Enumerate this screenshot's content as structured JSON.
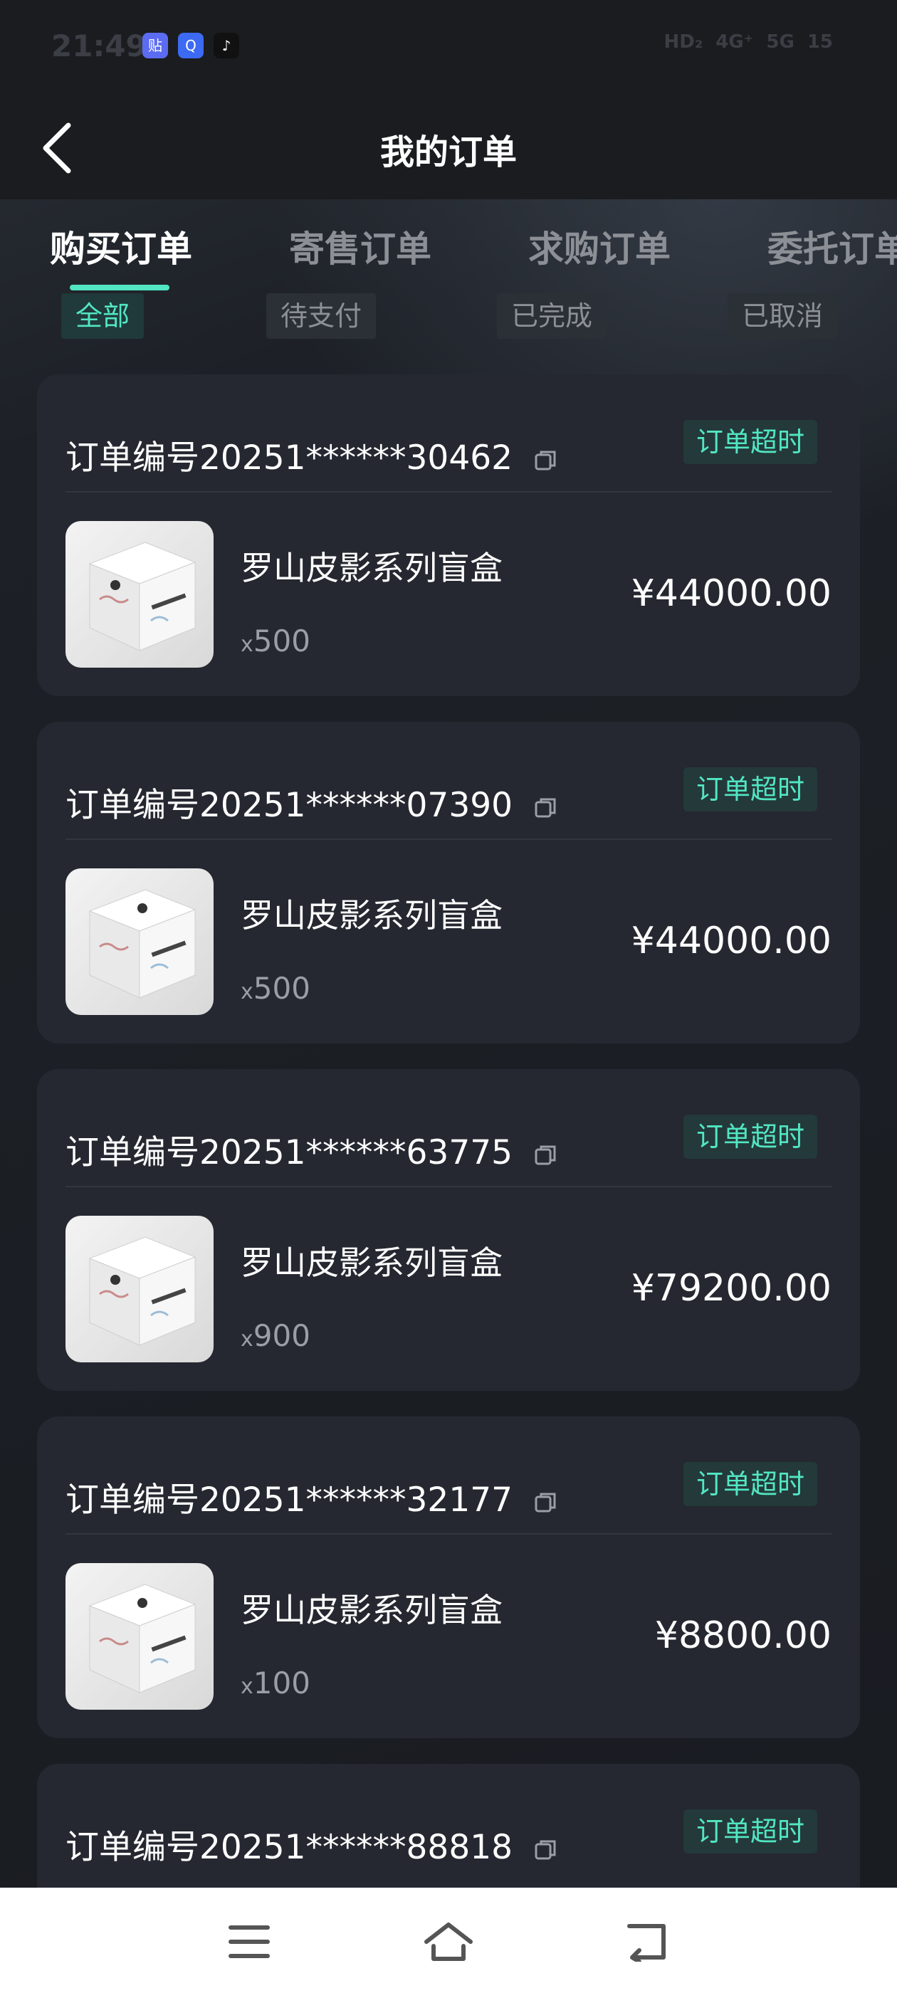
{
  "status_bar": {
    "time": "21:49",
    "apps": [
      {
        "icon": "tieba-icon",
        "glyph": "贴",
        "color": "#5b6cf2"
      },
      {
        "icon": "qq-icon",
        "glyph": "Q",
        "color": "#3d6af2"
      },
      {
        "icon": "music-icon",
        "glyph": "♪",
        "color": "#111111"
      }
    ],
    "right_items": [
      "HD₂",
      "4G⁺",
      "5G",
      "15"
    ]
  },
  "header": {
    "title": "我的订单",
    "back_icon": "chevron-left-icon"
  },
  "tabs": [
    {
      "label": "购买订单",
      "active": true
    },
    {
      "label": "寄售订单",
      "active": false
    },
    {
      "label": "求购订单",
      "active": false
    },
    {
      "label": "委托订单",
      "active": false
    }
  ],
  "subtabs": [
    {
      "label": "全部",
      "active": true
    },
    {
      "label": "待支付",
      "active": false
    },
    {
      "label": "已完成",
      "active": false
    },
    {
      "label": "已取消",
      "active": false
    }
  ],
  "orders": [
    {
      "order_no": "订单编号20251******30462",
      "status": "订单超时",
      "product": "罗山皮影系列盲盒",
      "qty_prefix": "x",
      "qty": "500",
      "price": "¥44000.00"
    },
    {
      "order_no": "订单编号20251******07390",
      "status": "订单超时",
      "product": "罗山皮影系列盲盒",
      "qty_prefix": "x",
      "qty": "500",
      "price": "¥44000.00"
    },
    {
      "order_no": "订单编号20251******63775",
      "status": "订单超时",
      "product": "罗山皮影系列盲盒",
      "qty_prefix": "x",
      "qty": "900",
      "price": "¥79200.00"
    },
    {
      "order_no": "订单编号20251******32177",
      "status": "订单超时",
      "product": "罗山皮影系列盲盒",
      "qty_prefix": "x",
      "qty": "100",
      "price": "¥8800.00"
    },
    {
      "order_no": "订单编号20251******88818",
      "status": "订单超时",
      "product": "",
      "qty_prefix": "",
      "qty": "",
      "price": ""
    }
  ],
  "bottom_nav": [
    "menu-icon",
    "home-icon",
    "back-icon"
  ],
  "colors": {
    "accent": "#52e6c3",
    "card": "#252830",
    "background": "#1b1e24"
  }
}
